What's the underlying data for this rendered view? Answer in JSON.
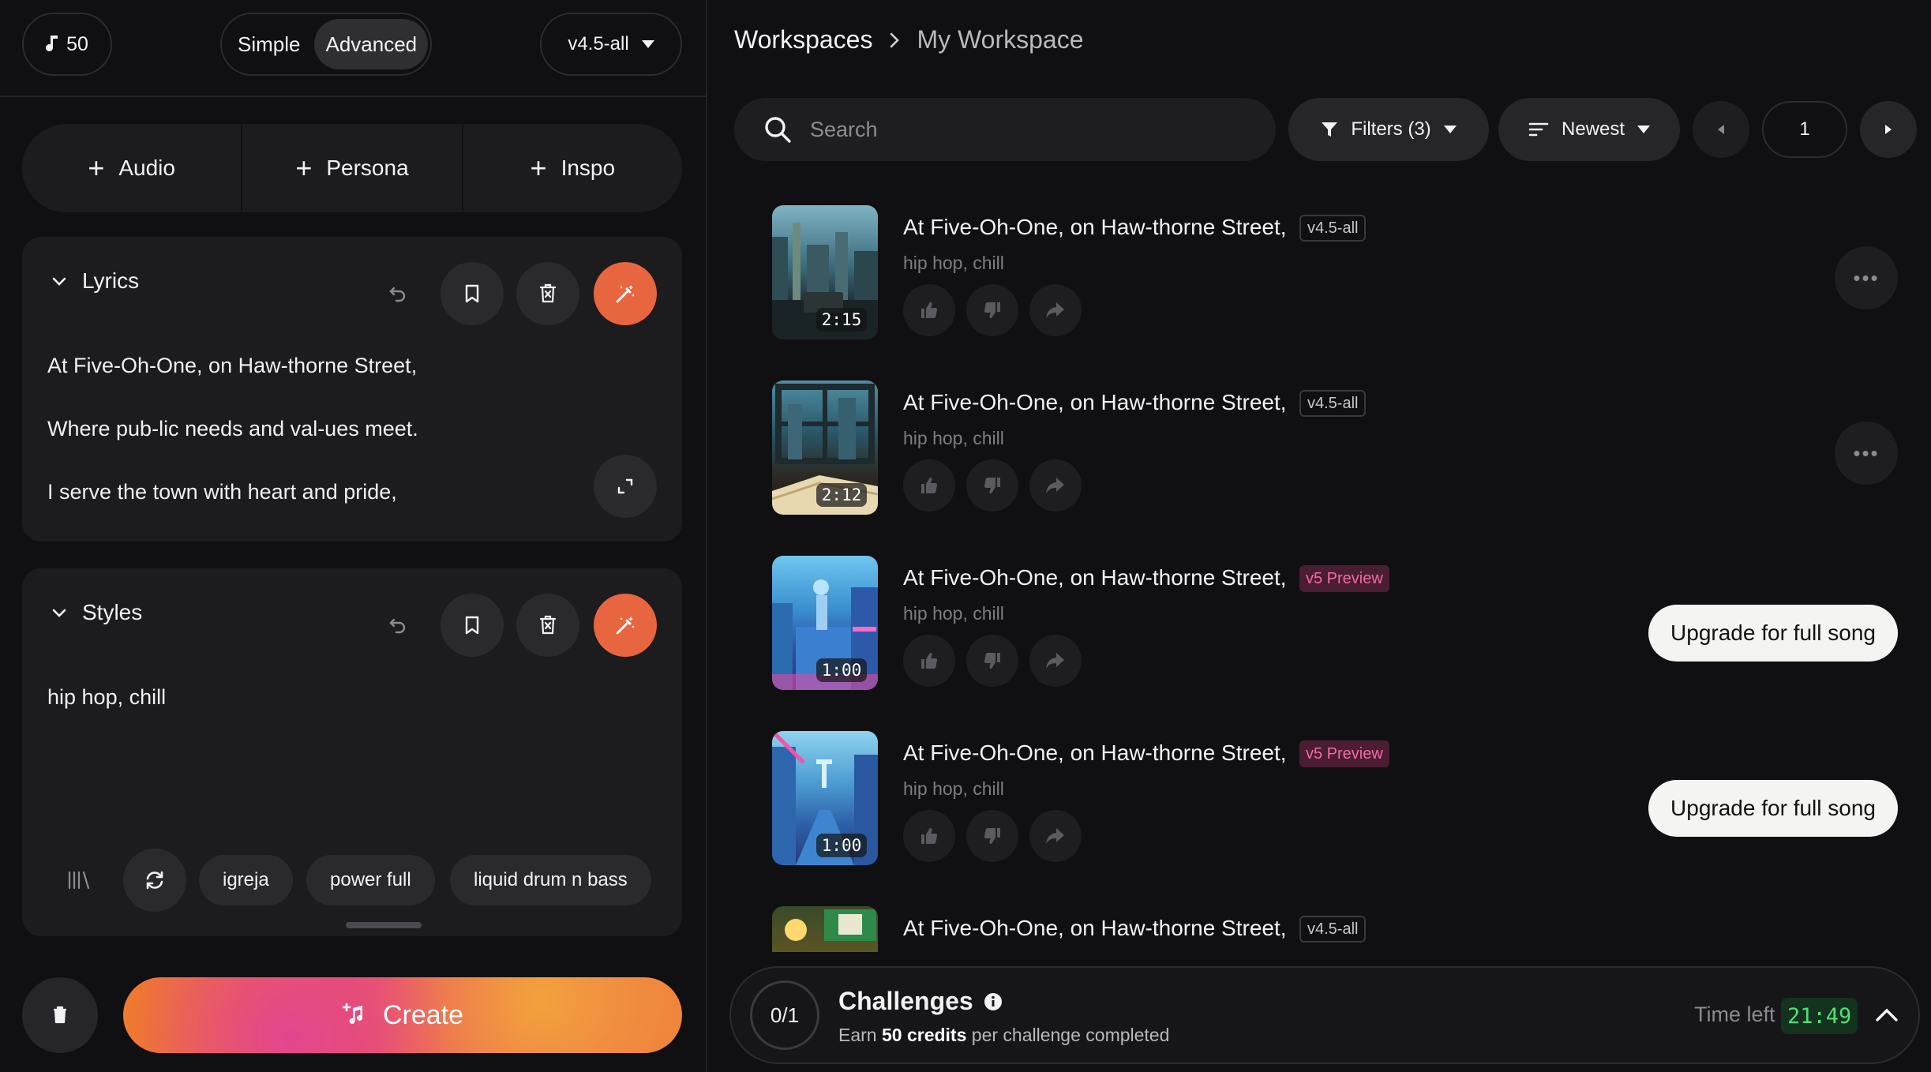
{
  "topbar": {
    "credits": "50",
    "mode_simple": "Simple",
    "mode_advanced": "Advanced",
    "version": "v4.5-all"
  },
  "add_buttons": {
    "audio": "Audio",
    "persona": "Persona",
    "inspo": "Inspo"
  },
  "lyrics": {
    "title": "Lyrics",
    "lines": [
      "At Five-Oh-One, on Haw-thorne Street,",
      "Where pub-lic needs and val-ues meet.",
      "I serve the town with heart and pride,"
    ]
  },
  "styles": {
    "title": "Styles",
    "text": "hip hop, chill",
    "chips": [
      "igreja",
      "power full",
      "liquid drum n bass"
    ]
  },
  "create_label": "Create",
  "breadcrumb": {
    "root": "Workspaces",
    "current": "My Workspace"
  },
  "search": {
    "placeholder": "Search"
  },
  "filters_label": "Filters (3)",
  "sort_label": "Newest",
  "page": "1",
  "songs": [
    {
      "title": "At Five-Oh-One, on Haw-thorne Street,",
      "version": "v4.5-all",
      "styles": "hip hop, chill",
      "duration": "2:15",
      "upgrade": ""
    },
    {
      "title": "At Five-Oh-One, on Haw-thorne Street,",
      "version": "v4.5-all",
      "styles": "hip hop, chill",
      "duration": "2:12",
      "upgrade": ""
    },
    {
      "title": "At Five-Oh-One, on Haw-thorne Street,",
      "version": "v5 Preview",
      "styles": "hip hop, chill",
      "duration": "1:00",
      "upgrade": "Upgrade for full song"
    },
    {
      "title": "At Five-Oh-One, on Haw-thorne Street,",
      "version": "v5 Preview",
      "styles": "hip hop, chill",
      "duration": "1:00",
      "upgrade": "Upgrade for full song"
    },
    {
      "title": "At Five-Oh-One, on Haw-thorne Street,",
      "version": "v4.5-all",
      "styles": "",
      "duration": "",
      "upgrade": ""
    }
  ],
  "challenges": {
    "progress": "0/1",
    "title": "Challenges",
    "sub_pre": "Earn",
    "sub_bold": "50 credits",
    "sub_post": "per challenge completed",
    "time_label": "Time left",
    "time_value": "21:49"
  },
  "colors": {
    "accent": "#e8663f",
    "preview_tag": "#f06aa6",
    "timer": "#4fe07a"
  }
}
